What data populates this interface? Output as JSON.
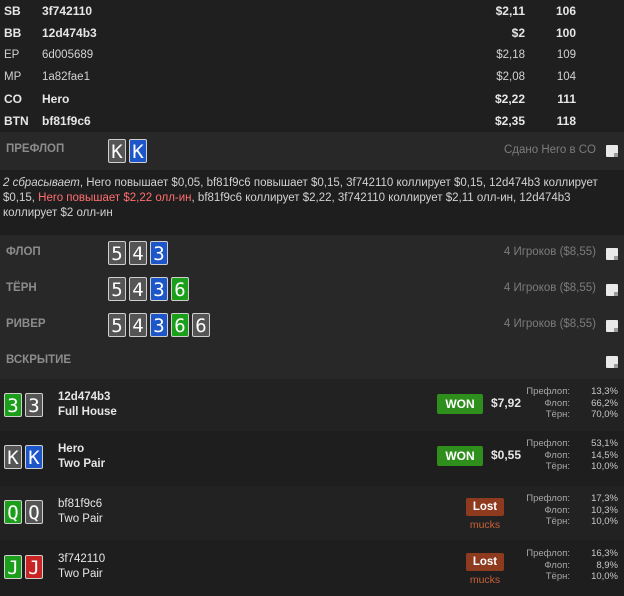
{
  "players": [
    {
      "pos": "SB",
      "name": "3f742110",
      "stack": "$2,11",
      "bb": "106",
      "bold": true
    },
    {
      "pos": "BB",
      "name": "12d474b3",
      "stack": "$2",
      "bb": "100",
      "bold": true
    },
    {
      "pos": "EP",
      "name": "6d005689",
      "stack": "$2,18",
      "bb": "109",
      "bold": false
    },
    {
      "pos": "MP",
      "name": "1a82fae1",
      "stack": "$2,08",
      "bb": "104",
      "bold": false
    },
    {
      "pos": "CO",
      "name": "Hero",
      "stack": "$2,22",
      "bb": "111",
      "bold": true
    },
    {
      "pos": "BTN",
      "name": "bf81f9c6",
      "stack": "$2,35",
      "bb": "118",
      "bold": true
    }
  ],
  "preflop": {
    "label": "ПРЕФЛОП",
    "dealt": "Сдано Hero в CO",
    "cards": [
      {
        "rank": "K",
        "suit": "gray"
      },
      {
        "rank": "K",
        "suit": "blue"
      }
    ]
  },
  "actions": {
    "part1": "2 сбрасывает",
    "part2": ", Hero повышает $0,05, bf81f9c6 повышает $0,15, 3f742110 коллирует $0,15, 12d474b3 коллирует $0,15, ",
    "part3": "Hero повышает $2,22 олл-ин",
    "part4": ", bf81f9c6 коллирует $2,22, 3f742110 коллирует $2,11 олл-ин, 12d474b3 коллирует $2 олл-ин"
  },
  "flop": {
    "label": "ФЛОП",
    "info": "4 Игроков ($8,55)",
    "cards": [
      {
        "rank": "5",
        "suit": "gray"
      },
      {
        "rank": "4",
        "suit": "gray"
      },
      {
        "rank": "3",
        "suit": "blue"
      }
    ]
  },
  "turn": {
    "label": "ТЁРН",
    "info": "4 Игроков ($8,55)",
    "cards": [
      {
        "rank": "5",
        "suit": "gray"
      },
      {
        "rank": "4",
        "suit": "gray"
      },
      {
        "rank": "3",
        "suit": "blue"
      },
      {
        "rank": "6",
        "suit": "green"
      }
    ]
  },
  "river": {
    "label": "РИВЕР",
    "info": "4 Игроков ($8,55)",
    "cards": [
      {
        "rank": "5",
        "suit": "gray"
      },
      {
        "rank": "4",
        "suit": "gray"
      },
      {
        "rank": "3",
        "suit": "blue"
      },
      {
        "rank": "6",
        "suit": "green"
      },
      {
        "rank": "6",
        "suit": "gray"
      }
    ]
  },
  "showdown": {
    "label": "ВСКРЫТИЕ"
  },
  "equity_labels": {
    "preflop": "Префлоп:",
    "flop": "Флоп:",
    "turn": "Тёрн:"
  },
  "results": [
    {
      "name": "12d474b3",
      "hand": "Full House",
      "status": "WON",
      "amount": "$7,92",
      "cards": [
        {
          "rank": "3",
          "suit": "green"
        },
        {
          "rank": "3",
          "suit": "gray"
        }
      ],
      "equity": {
        "preflop": "13,3%",
        "flop": "66,2%",
        "turn": "70,0%"
      }
    },
    {
      "name": "Hero",
      "hand": "Two Pair",
      "status": "WON",
      "amount": "$0,55",
      "cards": [
        {
          "rank": "K",
          "suit": "gray"
        },
        {
          "rank": "K",
          "suit": "blue"
        }
      ],
      "equity": {
        "preflop": "53,1%",
        "flop": "14,5%",
        "turn": "10,0%"
      }
    },
    {
      "name": "bf81f9c6",
      "hand": "Two Pair",
      "status": "Lost",
      "note": "mucks",
      "cards": [
        {
          "rank": "Q",
          "suit": "green"
        },
        {
          "rank": "Q",
          "suit": "gray"
        }
      ],
      "equity": {
        "preflop": "17,3%",
        "flop": "10,3%",
        "turn": "10,0%"
      }
    },
    {
      "name": "3f742110",
      "hand": "Two Pair",
      "status": "Lost",
      "note": "mucks",
      "cards": [
        {
          "rank": "J",
          "suit": "green"
        },
        {
          "rank": "J",
          "suit": "red"
        }
      ],
      "equity": {
        "preflop": "16,3%",
        "flop": "8,9%",
        "turn": "10,0%"
      }
    }
  ],
  "colors": {
    "background": "#1e1e1e",
    "street_bg": "#282828",
    "card_gray": "#555555",
    "card_blue": "#1d56c9",
    "card_green": "#1b9f1b",
    "card_red": "#c92424",
    "won": "#2f8f1d",
    "lost": "#8e3a1e",
    "allin_text": "#ff6f6f"
  }
}
